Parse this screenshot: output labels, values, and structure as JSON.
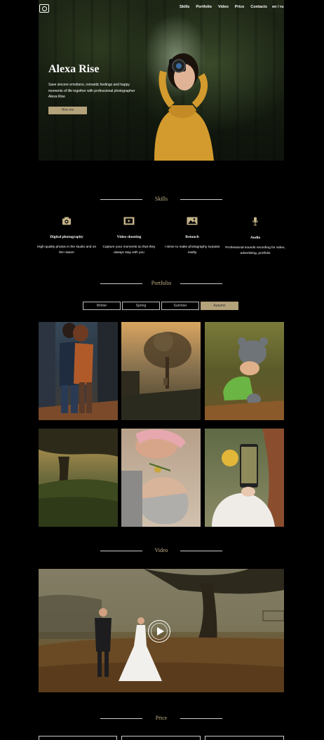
{
  "header": {
    "logo": "camera-logo-icon",
    "nav": [
      "Skills",
      "Portfolio",
      "Video",
      "Price",
      "Contacts"
    ],
    "lang": "en / ru"
  },
  "hero": {
    "title": "Alexa Rise",
    "description": "Save sincere emotions, romantic feelings and happy moments of life together with professional photographer Alexa Rise",
    "button": "Hire me"
  },
  "sections": {
    "skills": "Skills",
    "portfolio": "Portfolio",
    "video": "Video",
    "price": "Price"
  },
  "skills": [
    {
      "icon": "camera-icon",
      "title": "Digital photography",
      "text": "High-quality photos in the studio and on the nature"
    },
    {
      "icon": "film-icon",
      "title": "Video shooting",
      "text": "Capture your moments so that they always stay with you"
    },
    {
      "icon": "image-icon",
      "title": "Retouch",
      "text": "I strive to make photography surpass reality"
    },
    {
      "icon": "microphone-icon",
      "title": "Audio",
      "text": "Professional sounds recording for video, advertising, portfolio"
    }
  ],
  "portfolio": {
    "tabs": [
      "Winter",
      "Spring",
      "Summer",
      "Autumn"
    ],
    "active_tab": "Autumn"
  },
  "colors": {
    "accent": "#b4a27a",
    "background": "#000000",
    "text": "#ffffff"
  }
}
